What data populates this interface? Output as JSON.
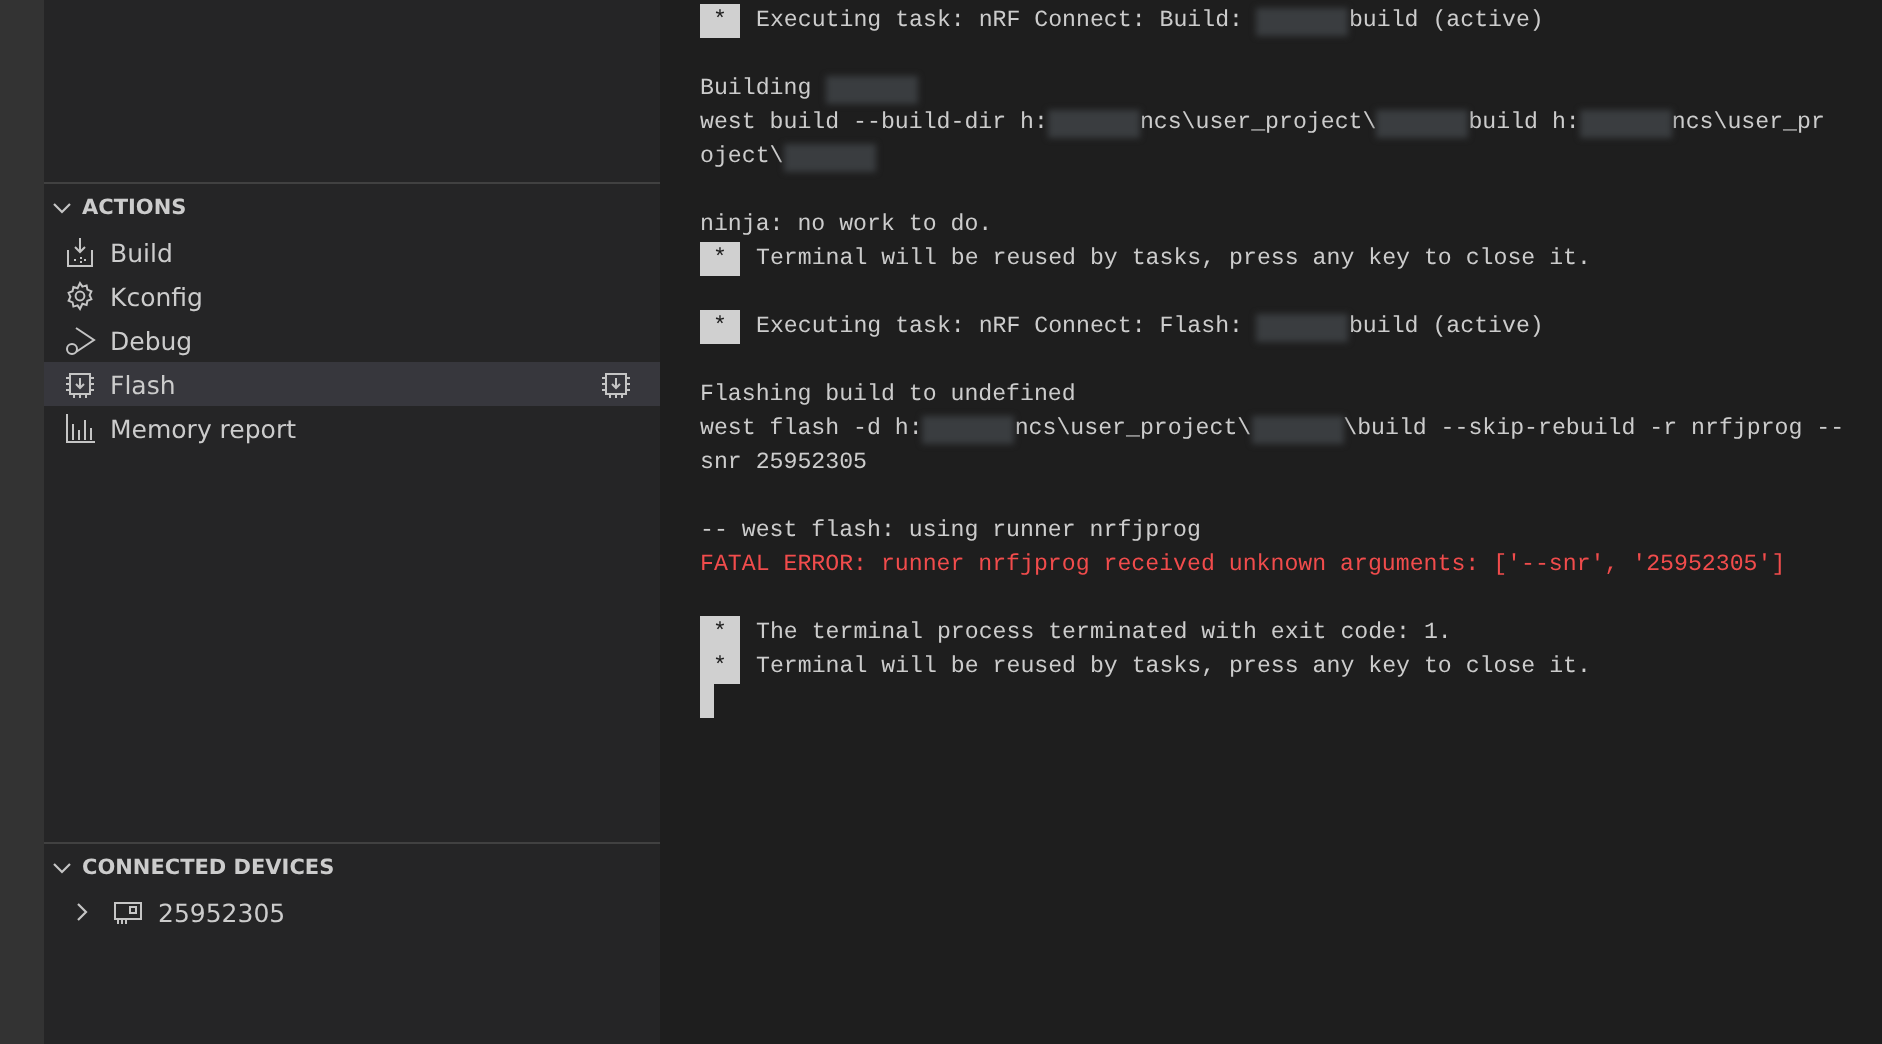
{
  "sidebar": {
    "sections": [
      {
        "title": "ACTIONS",
        "expanded": true,
        "items": [
          {
            "label": "Build",
            "selected": false
          },
          {
            "label": "Kconfig",
            "selected": false
          },
          {
            "label": "Debug",
            "selected": false
          },
          {
            "label": "Flash",
            "selected": true
          },
          {
            "label": "Memory report",
            "selected": false
          }
        ]
      },
      {
        "title": "CONNECTED DEVICES",
        "expanded": true,
        "items": [
          {
            "label": "25952305",
            "expanded": false,
            "selected": false
          }
        ]
      }
    ]
  },
  "terminal": {
    "lines": [
      {
        "kind": "task",
        "marker": "*",
        "parts": [
          {
            "kind": "text",
            "text": "Executing task: nRF Connect: Build: "
          },
          {
            "kind": "redacted"
          },
          {
            "kind": "text",
            "text": "build (active)"
          }
        ]
      },
      {
        "kind": "blank"
      },
      {
        "kind": "text",
        "parts": [
          {
            "kind": "text",
            "text": "Building "
          },
          {
            "kind": "redacted"
          }
        ]
      },
      {
        "kind": "text",
        "parts": [
          {
            "kind": "text",
            "text": "west build --build-dir h:"
          },
          {
            "kind": "redacted"
          },
          {
            "kind": "text",
            "text": "ncs\\user_project\\"
          },
          {
            "kind": "redacted"
          },
          {
            "kind": "text",
            "text": "build h:"
          },
          {
            "kind": "redacted"
          },
          {
            "kind": "text",
            "text": "ncs\\user_pr"
          }
        ]
      },
      {
        "kind": "text",
        "parts": [
          {
            "kind": "text",
            "text": "oject\\"
          },
          {
            "kind": "redacted"
          }
        ]
      },
      {
        "kind": "blank"
      },
      {
        "kind": "text",
        "parts": [
          {
            "kind": "text",
            "text": "ninja: no work to do."
          }
        ]
      },
      {
        "kind": "task",
        "marker": "*",
        "parts": [
          {
            "kind": "text",
            "text": "Terminal will be reused by tasks, press any key to close it."
          }
        ]
      },
      {
        "kind": "blank"
      },
      {
        "kind": "task",
        "marker": "*",
        "parts": [
          {
            "kind": "text",
            "text": "Executing task: nRF Connect: Flash: "
          },
          {
            "kind": "redacted"
          },
          {
            "kind": "text",
            "text": "build (active)"
          }
        ]
      },
      {
        "kind": "blank"
      },
      {
        "kind": "text",
        "parts": [
          {
            "kind": "text",
            "text": "Flashing build to undefined"
          }
        ]
      },
      {
        "kind": "text",
        "parts": [
          {
            "kind": "text",
            "text": "west flash -d h:"
          },
          {
            "kind": "redacted"
          },
          {
            "kind": "text",
            "text": "ncs\\user_project\\"
          },
          {
            "kind": "redacted"
          },
          {
            "kind": "text",
            "text": "\\build --skip-rebuild -r nrfjprog --"
          }
        ]
      },
      {
        "kind": "text",
        "parts": [
          {
            "kind": "text",
            "text": "snr 25952305"
          }
        ]
      },
      {
        "kind": "blank"
      },
      {
        "kind": "text",
        "parts": [
          {
            "kind": "text",
            "text": "-- west flash: using runner nrfjprog"
          }
        ]
      },
      {
        "kind": "error",
        "parts": [
          {
            "kind": "text",
            "text": "FATAL ERROR: runner nrfjprog received unknown arguments: ['--snr', '25952305']"
          }
        ]
      },
      {
        "kind": "blank"
      },
      {
        "kind": "task",
        "marker": "*",
        "parts": [
          {
            "kind": "text",
            "text": "The terminal process terminated with exit code: 1."
          }
        ]
      },
      {
        "kind": "task",
        "marker": "*",
        "parts": [
          {
            "kind": "text",
            "text": "Terminal will be reused by tasks, press any key to close it."
          }
        ]
      },
      {
        "kind": "cursor"
      }
    ]
  }
}
